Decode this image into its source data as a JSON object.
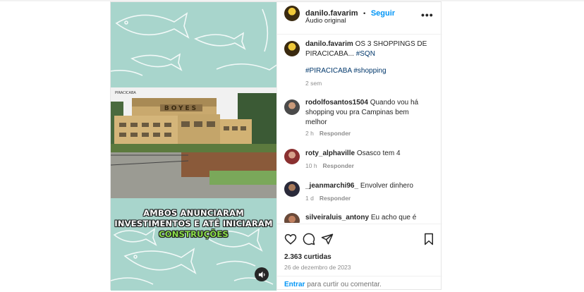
{
  "post": {
    "username": "danilo.favarim",
    "follow_label": "Seguir",
    "separator": "•",
    "audio": "Áudio original",
    "more_label": "•••"
  },
  "media": {
    "overlay_line1": "AMBOS ANUNCIARAM",
    "overlay_line2": "INVESTIMENTOS E ATÉ INICIARAM",
    "overlay_line3": "CONSTRUÇÕES",
    "building_sign": "BOYES",
    "photo_watermark": "PIRACICABA"
  },
  "caption": {
    "username": "danilo.favarim",
    "text": "OS 3 SHOPPINGS DE PIRACICABA...",
    "tag1": "#SQN",
    "tag2": "#PIRACICABA",
    "tag3": "#shopping",
    "time": "2 sem"
  },
  "comments": [
    {
      "username": "rodolfosantos1504",
      "text": "Quando vou há shopping vou pra Campinas bem melhor",
      "time": "2 h",
      "reply": "Responder"
    },
    {
      "username": "roty_alphaville",
      "text": "Osasco tem 4",
      "time": "10 h",
      "reply": "Responder"
    },
    {
      "username": "_jeanmarchi96_",
      "text": "Envolver dinhero",
      "time": "1 d",
      "reply": "Responder"
    },
    {
      "username": "silveiraluis_antony",
      "text": "Eu acho que é",
      "time": "",
      "reply": ""
    }
  ],
  "actions": {
    "likes": "2.363 curtidas",
    "date": "26 de dezembro de 2023",
    "login_link": "Entrar",
    "login_text": "para curtir ou comentar."
  },
  "colors": {
    "accent": "#0095f6",
    "media_bg": "#a8d5cc",
    "overlay_highlight": "#8be04a"
  }
}
